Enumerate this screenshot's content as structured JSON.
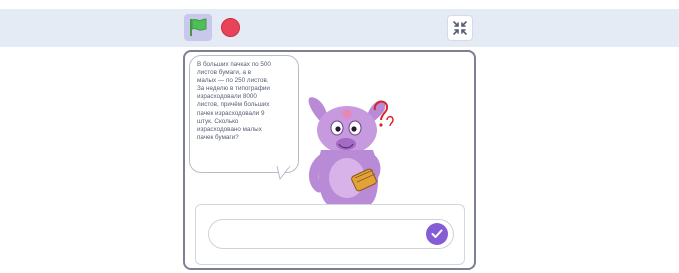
{
  "controls": {
    "green_flag_icon": "green-flag-icon",
    "stop_icon": "stop-icon",
    "fullscreen_icon": "fullscreen-exit-icon"
  },
  "stage": {
    "speech_bubble": {
      "lines": [
        "В больших пачках по 500",
        "листов бумаги, а в",
        "малых — по 250 листов.",
        "За неделю в типографии",
        "израсходовали 8000",
        "листов, причём больших",
        "пачек израсходовали 9",
        "штук. Сколько",
        "израсходовано малых",
        "пачек бумаги?"
      ]
    },
    "sprite_name": "luntik-character"
  },
  "ask_prompt": {
    "input_value": "",
    "submit_icon": "checkmark-icon"
  },
  "colors": {
    "accent": "#855cd6",
    "toolbar_bg": "#e5ebf5",
    "stop_red": "#e9435a",
    "flag_green": "#4cbf56",
    "sprite_purple": "#b98ad6"
  }
}
